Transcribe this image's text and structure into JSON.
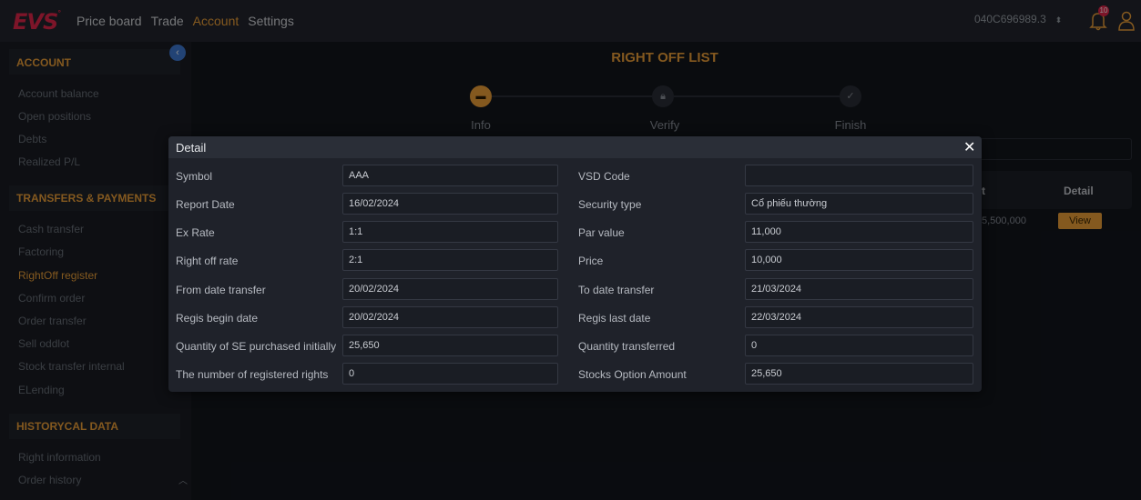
{
  "nav": {
    "logo": "EVS",
    "items": [
      "Price board",
      "Trade",
      "Account",
      "Settings"
    ],
    "account_number": "040C696989.3",
    "notification_count": "10"
  },
  "sidebar": {
    "sections": [
      {
        "title": "ACCOUNT",
        "items": [
          "Account balance",
          "Open positions",
          "Debts",
          "Realized P/L"
        ]
      },
      {
        "title": "TRANSFERS & PAYMENTS",
        "items": [
          "Cash transfer",
          "Factoring",
          "RightOff register",
          "Confirm order",
          "Order transfer",
          "Sell oddlot",
          "Stock transfer internal",
          "ELending"
        ]
      },
      {
        "title": "HISTORYCAL DATA",
        "items": [
          "Right information",
          "Order history"
        ]
      }
    ]
  },
  "main": {
    "title": "RIGHT OFF LIST",
    "steps": [
      "Info",
      "Verify",
      "Finish"
    ],
    "table": {
      "col_t": "t",
      "col_detail": "Detail",
      "cell": "5,500,000",
      "view_label": "View"
    }
  },
  "modal": {
    "title": "Detail",
    "left_fields": [
      {
        "label": "Symbol",
        "value": "AAA"
      },
      {
        "label": "Report Date",
        "value": "16/02/2024"
      },
      {
        "label": "Ex Rate",
        "value": "1:1"
      },
      {
        "label": "Right off rate",
        "value": "2:1"
      },
      {
        "label": "From date transfer",
        "value": "20/02/2024"
      },
      {
        "label": "Regis begin date",
        "value": "20/02/2024"
      },
      {
        "label": "Quantity of SE purchased initially",
        "value": "25,650"
      },
      {
        "label": "The number of registered rights",
        "value": "0"
      }
    ],
    "right_fields": [
      {
        "label": "VSD Code",
        "value": ""
      },
      {
        "label": "Security type",
        "value": "Cổ phiếu thường"
      },
      {
        "label": "Par value",
        "value": "11,000"
      },
      {
        "label": "Price",
        "value": "10,000"
      },
      {
        "label": "To date transfer",
        "value": "21/03/2024"
      },
      {
        "label": "Regis last date",
        "value": "22/03/2024"
      },
      {
        "label": "Quantity transferred",
        "value": "0"
      },
      {
        "label": "Stocks Option Amount",
        "value": "25,650"
      }
    ]
  }
}
